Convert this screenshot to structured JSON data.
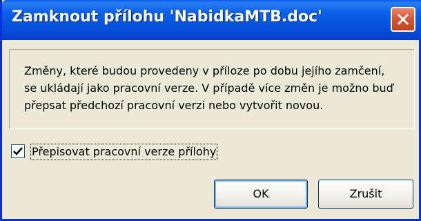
{
  "window": {
    "title": "Zamknout přílohu 'NabidkaMTB.doc'",
    "close_icon": "close-icon"
  },
  "info": {
    "lines": [
      "Změny, které budou provedeny v příloze po dobu jejího zamčení,",
      "se ukládají jako pracovní verze. V případě více změn je možno buď",
      "přepsat předchozí pracovní verzi nebo vytvořit novou."
    ]
  },
  "option": {
    "label": "Přepisovat pracovní verze přílohy",
    "checked": true
  },
  "buttons": {
    "ok": "OK",
    "cancel": "Zrušit"
  },
  "colors": {
    "titlebar": "#0553de",
    "dialog_bg": "#ece9d8",
    "close": "#d65a37"
  }
}
